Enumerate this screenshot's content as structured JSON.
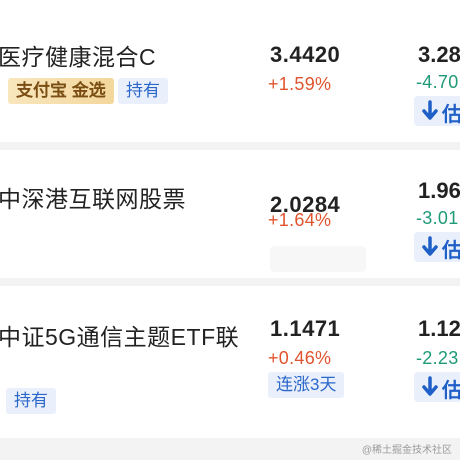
{
  "funds": [
    {
      "name": "医疗健康混合C",
      "nav": "3.4420",
      "change": "+1.59%",
      "est_nav": "3.28",
      "est_change": "-4.70",
      "est_label": "估",
      "tags": {
        "platform": "支付宝 金选",
        "hold": "持有"
      }
    },
    {
      "name": "中深港互联网股票",
      "nav": "2.0284",
      "change": "+1.64%",
      "est_nav": "1.96",
      "est_change": "-3.01",
      "est_label": "估"
    },
    {
      "name": "中证5G通信主题ETF联",
      "nav": "1.1471",
      "change": "+0.46%",
      "est_nav": "1.12",
      "est_change": "-2.23",
      "est_label": "估",
      "tags": {
        "streak": "连涨3天",
        "hold": "持有"
      }
    }
  ],
  "watermark": "@稀土掘金技术社区",
  "colors": {
    "up": "#e0542f",
    "down": "#1f9a78",
    "accent_blue": "#2b66c9",
    "badge_bg": "#e9f0fb"
  },
  "icons": {
    "estimate_arrow": "arrow-down-icon"
  }
}
